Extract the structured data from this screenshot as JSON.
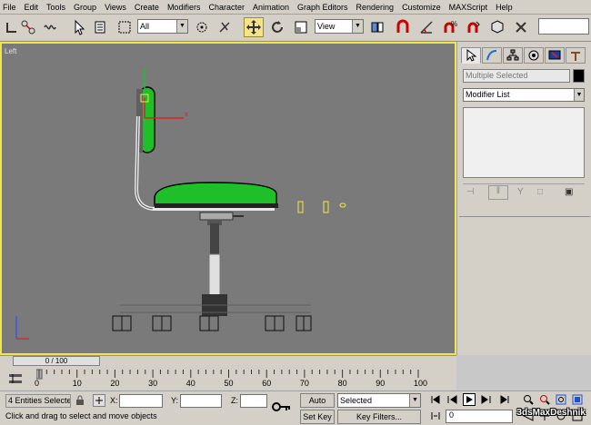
{
  "menu": [
    "File",
    "Edit",
    "Tools",
    "Group",
    "Views",
    "Create",
    "Modifiers",
    "Character",
    "Animation",
    "Graph Editors",
    "Rendering",
    "Customize",
    "MAXScript",
    "Help"
  ],
  "toolbar": {
    "selection_filter": "All",
    "ref_coord": "View"
  },
  "viewport": {
    "label": "Left",
    "gizmo_x_label": "x",
    "gizmo_y_label": "y"
  },
  "command_panel": {
    "name_field": "Multiple Selected",
    "modifier_list": "Modifier List"
  },
  "time_slider": {
    "frame_display": "0 / 100",
    "ticks": [
      "0",
      "10",
      "20",
      "30",
      "40",
      "50",
      "60",
      "70",
      "80",
      "90",
      "100"
    ]
  },
  "status": {
    "selection_count": "4 Entities Selecte",
    "prompt": "Click and drag to select and move objects",
    "x_label": "X:",
    "y_label": "Y:",
    "z_label": "Z:",
    "auto_key": "Auto Key",
    "set_key": "Set Key",
    "key_mode": "Selected",
    "key_filters": "Key Filters...",
    "current_frame": "0"
  },
  "watermark": "3dsMaxDeshnik",
  "colors": {
    "viewport_bg": "#7a7a7a",
    "active_border": "#f0e64a",
    "seat_green": "#1fbf2a"
  }
}
